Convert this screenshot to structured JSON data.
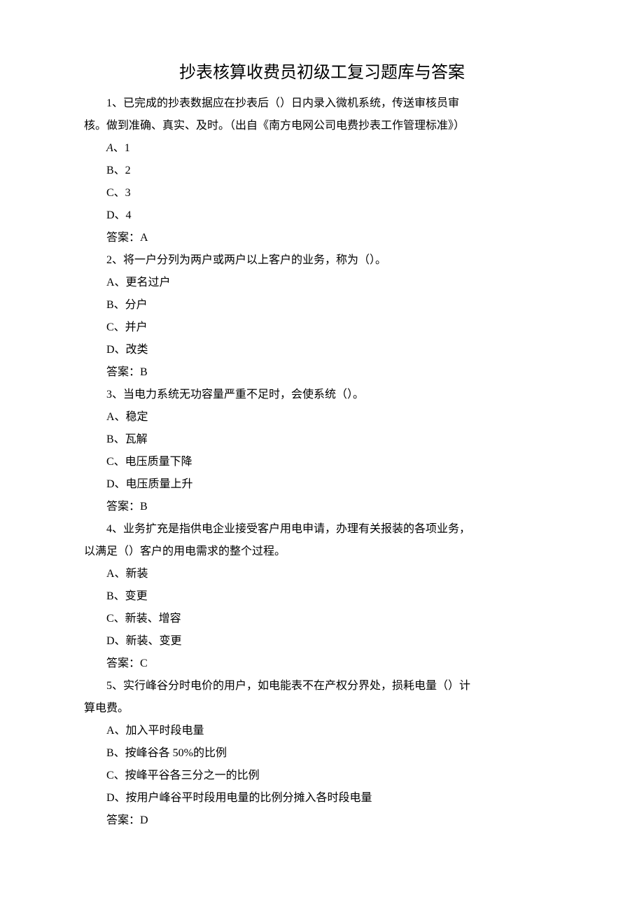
{
  "title": "抄表核算收费员初级工复习题库与答案",
  "q1": {
    "stem_line1": "1、已完成的抄表数据应在抄表后（）日内录入微机系统，传送审核员审",
    "stem_line2": "核。做到准确、真实、及时。（出自《南方电网公司电费抄表工作管理标准》）",
    "optA_prefix": "A",
    "optA_rest": "、1",
    "optB": "B、2",
    "optC": "C、3",
    "optD": "D、4",
    "answer": "答案：A"
  },
  "q2": {
    "stem": "2、将一户分列为两户或两户以上客户的业务，称为（）。",
    "optA": "A、更名过户",
    "optB": "B、分户",
    "optC": "C、并户",
    "optD": "D、改类",
    "answer": "答案：B"
  },
  "q3": {
    "stem": "3、当电力系统无功容量严重不足时，会使系统（）。",
    "optA": "A、稳定",
    "optB": "B、瓦解",
    "optC": "C、电压质量下降",
    "optD": "D、电压质量上升",
    "answer": "答案：B"
  },
  "q4": {
    "stem_line1": "4、业务扩充是指供电企业接受客户用电申请，办理有关报装的各项业务，",
    "stem_line2": "以满足（）客户的用电需求的整个过程。",
    "optA": "A、新装",
    "optB": "B、变更",
    "optC": "C、新装、增容",
    "optD": "D、新装、变更",
    "answer": "答案：C"
  },
  "q5": {
    "stem_line1": "5、实行峰谷分时电价的用户，如电能表不在产权分界处，损耗电量（）计",
    "stem_line2": "算电费。",
    "optA": "A、加入平时段电量",
    "optB": "B、按峰谷各 50%的比例",
    "optC": "C、按峰平谷各三分之一的比例",
    "optD": "D、按用户峰谷平时段用电量的比例分摊入各时段电量",
    "answer": "答案：D"
  }
}
